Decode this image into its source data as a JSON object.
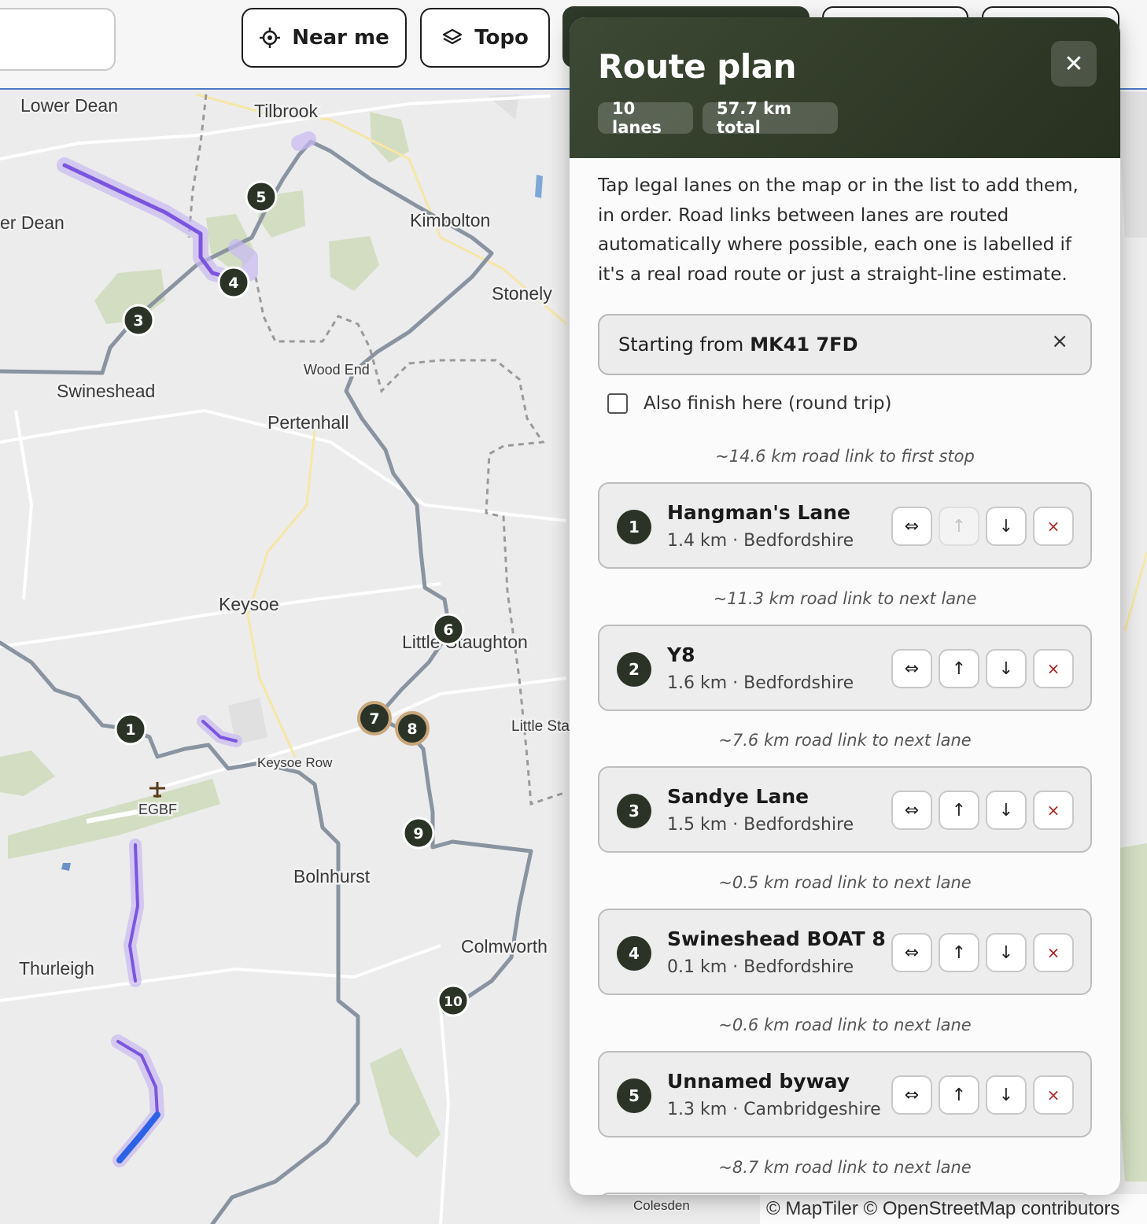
{
  "toolbar": {
    "near_me_label": "Near me",
    "topo_label": "Topo"
  },
  "map": {
    "places": [
      {
        "name": "Lower Dean"
      },
      {
        "name": "Tilbrook"
      },
      {
        "name": "er Dean"
      },
      {
        "name": "Kimbolton"
      },
      {
        "name": "Stonely"
      },
      {
        "name": "Wood End"
      },
      {
        "name": "Swineshead"
      },
      {
        "name": "Pertenhall"
      },
      {
        "name": "Keysoe"
      },
      {
        "name": "Little Staughton"
      },
      {
        "name": "Little Sta"
      },
      {
        "name": "Keysoe Row"
      },
      {
        "name": "EGBF"
      },
      {
        "name": "Bolnhurst"
      },
      {
        "name": "Colmworth"
      },
      {
        "name": "Thurleigh"
      },
      {
        "name": "Colesden"
      }
    ],
    "stop_markers": [
      "1",
      "2",
      "3",
      "4",
      "5",
      "6",
      "7",
      "8",
      "9",
      "10"
    ],
    "attribution": "© MapTiler © OpenStreetMap contributors"
  },
  "panel": {
    "title": "Route plan",
    "chips": [
      "10 lanes",
      "57.7 km total"
    ],
    "close_label": "✕",
    "intro": "Tap legal lanes on the map or in the list to add them, in order. Road links between lanes are routed automatically where possible, each one is labelled if it's a real road route or just a straight-line estimate.",
    "start_prefix": "Starting from",
    "start_postcode": "MK41 7FD",
    "start_clear": "×",
    "round_trip_label": "Also finish here (round trip)",
    "links": [
      "~14.6 km road link to first stop",
      "~11.3 km road link to next lane",
      "~7.6 km road link to next lane",
      "~0.5 km road link to next lane",
      "~0.6 km road link to next lane",
      "~8.7 km road link to next lane"
    ],
    "lanes": [
      {
        "num": "1",
        "name": "Hangman's Lane",
        "meta": "1.4 km · Bedfordshire",
        "up_disabled": true
      },
      {
        "num": "2",
        "name": "Y8",
        "meta": "1.6 km · Bedfordshire",
        "up_disabled": false
      },
      {
        "num": "3",
        "name": "Sandye Lane",
        "meta": "1.5 km · Bedfordshire",
        "up_disabled": false
      },
      {
        "num": "4",
        "name": "Swineshead BOAT 8",
        "meta": "0.1 km · Bedfordshire",
        "up_disabled": false
      },
      {
        "num": "5",
        "name": "Unnamed byway",
        "meta": "1.3 km · Cambridgeshire",
        "up_disabled": false
      }
    ],
    "controls": {
      "reverse": "⇔",
      "up": "↑",
      "down": "↓",
      "remove": "×"
    }
  },
  "colors": {
    "panel_header": "#2f3a2a",
    "route": "#8a93a0",
    "lane_highlight": "#7b55e0",
    "marker": "#2b3327"
  }
}
